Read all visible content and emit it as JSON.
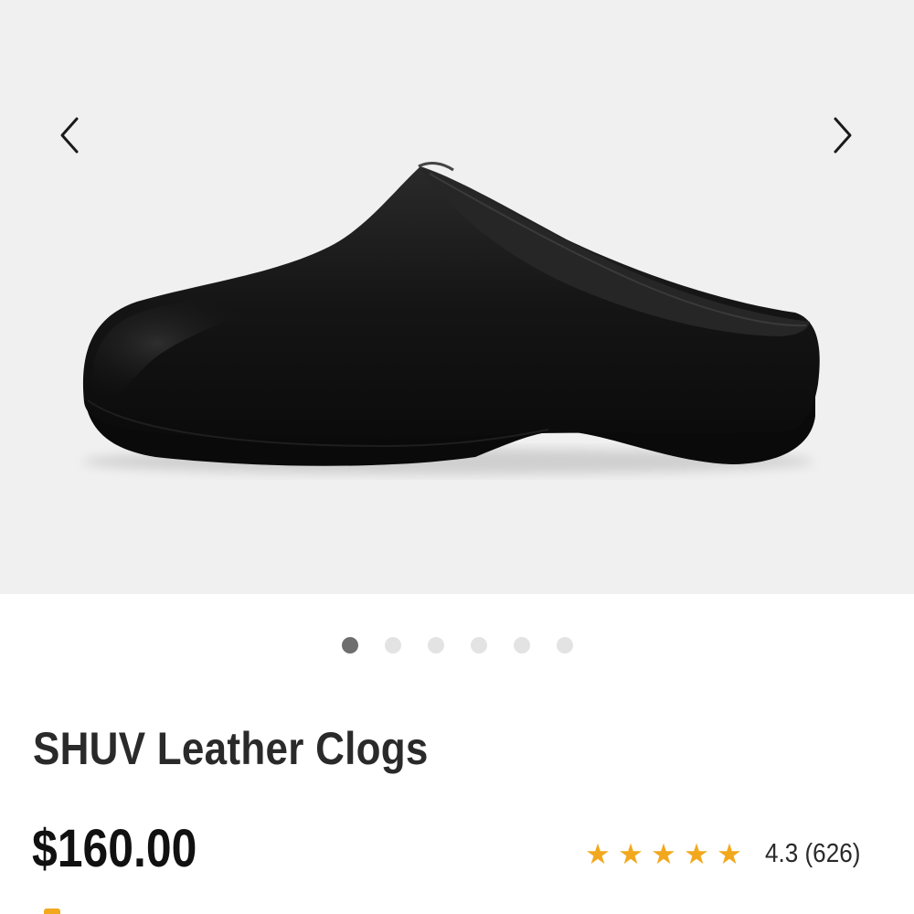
{
  "gallery": {
    "image_alt": "SHUV Leather Clogs",
    "prev_icon": "chevron-left-icon",
    "next_icon": "chevron-right-icon",
    "slide_count": 6,
    "active_slide": 1
  },
  "product": {
    "title": "SHUV Leather Clogs",
    "price": "$160.00",
    "rating": {
      "stars": 5,
      "value": "4.3",
      "count": "(626)",
      "star_color": "#f2a81d"
    }
  }
}
